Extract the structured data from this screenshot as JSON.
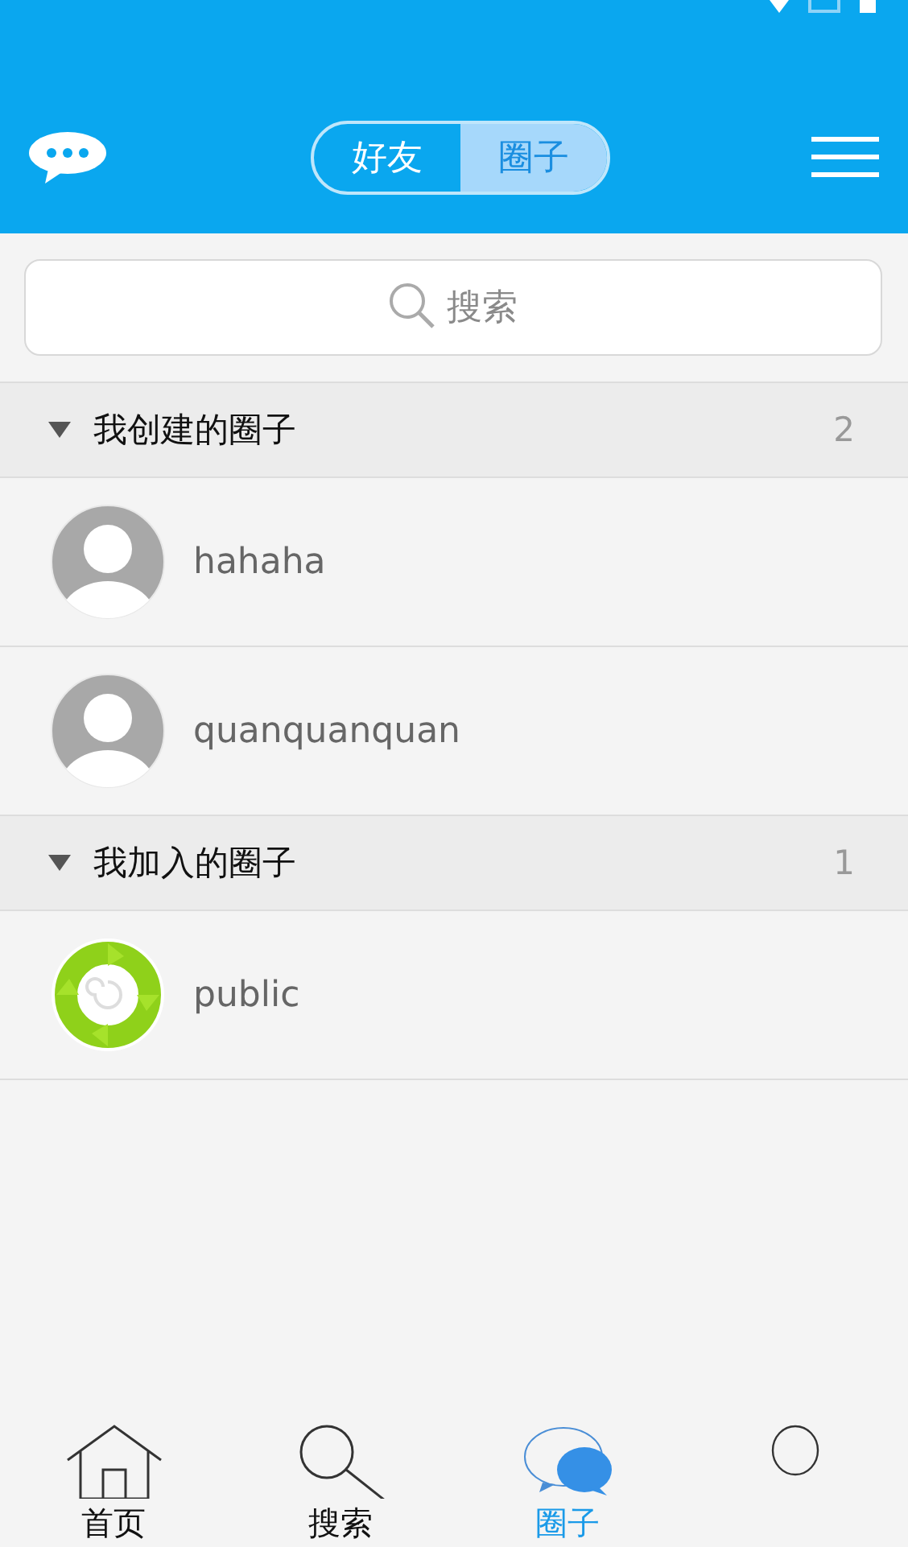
{
  "header": {
    "segments": [
      {
        "label": "好友",
        "selected": false
      },
      {
        "label": "圈子",
        "selected": true
      }
    ]
  },
  "search": {
    "placeholder": "搜索"
  },
  "groups": [
    {
      "title": "我创建的圈子",
      "count": "2",
      "expanded": true,
      "items": [
        {
          "name": "hahaha",
          "kind": "person"
        },
        {
          "name": "quanquanquan",
          "kind": "person"
        }
      ]
    },
    {
      "title": "我加入的圈子",
      "count": "1",
      "expanded": true,
      "items": [
        {
          "name": "public",
          "kind": "logo"
        }
      ]
    }
  ],
  "tabbar": [
    {
      "label": "首页",
      "kind": "home",
      "selected": false
    },
    {
      "label": "搜索",
      "kind": "search",
      "selected": false
    },
    {
      "label": "圈子",
      "kind": "chat",
      "selected": true
    },
    {
      "kind": "person",
      "selected": false
    }
  ]
}
